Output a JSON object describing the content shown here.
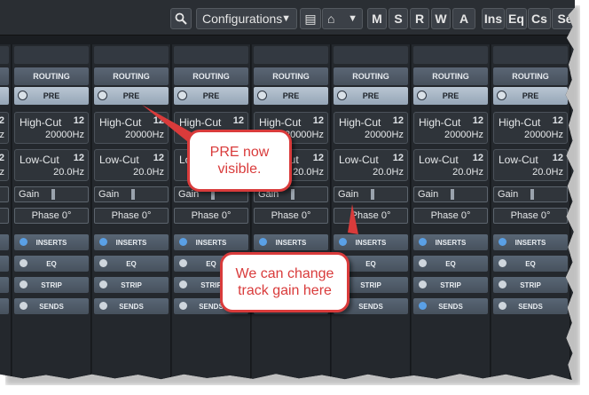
{
  "toolbar": {
    "search_icon": "search-icon",
    "configurations_label": "Configurations",
    "configurations_arrow": "▼",
    "list_icon_glyph": "▤",
    "window_icon_glyph": "⌂",
    "window_arrow": "▼",
    "mode_buttons": [
      "M",
      "S",
      "R",
      "W",
      "A"
    ],
    "section_buttons": [
      "Ins",
      "Eq",
      "Cs",
      "Se"
    ]
  },
  "channel": {
    "routing_label": "ROUTING",
    "pre_label": "PRE",
    "high_cut_label": "High-Cut",
    "high_cut_value": "20000Hz",
    "low_cut_label": "Low-Cut",
    "low_cut_value": "20.0Hz",
    "filter_badge": "12",
    "gain_label": "Gain",
    "phase_label": "Phase 0°",
    "inserts_label": "INSERTS",
    "eq_label": "EQ",
    "strip_label": "STRIP",
    "sends_label": "SENDS"
  },
  "callouts": {
    "pre_visible": "PRE now visible.",
    "track_gain": "We can change track gain here"
  },
  "colors": {
    "accent_red": "#d93b3b",
    "led_on": "#5aa0e6",
    "panel_bg": "#24282d"
  }
}
